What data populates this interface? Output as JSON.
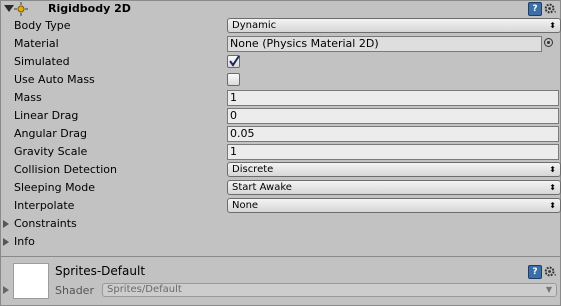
{
  "component": {
    "title": "Rigidbody 2D",
    "help_glyph": "?",
    "icons": [
      "fold-triangle-icon",
      "rigidbody-2d-icon",
      "help-book-icon",
      "gear-icon"
    ]
  },
  "properties": {
    "body_type": {
      "label": "Body Type",
      "value": "Dynamic"
    },
    "material": {
      "label": "Material",
      "value": "None (Physics Material 2D)"
    },
    "simulated": {
      "label": "Simulated",
      "checked": true
    },
    "use_auto_mass": {
      "label": "Use Auto Mass",
      "checked": false
    },
    "mass": {
      "label": "Mass",
      "value": "1"
    },
    "linear_drag": {
      "label": "Linear Drag",
      "value": "0"
    },
    "angular_drag": {
      "label": "Angular Drag",
      "value": "0.05"
    },
    "gravity_scale": {
      "label": "Gravity Scale",
      "value": "1"
    },
    "collision_detection": {
      "label": "Collision Detection",
      "value": "Discrete"
    },
    "sleeping_mode": {
      "label": "Sleeping Mode",
      "value": "Start Awake"
    },
    "interpolate": {
      "label": "Interpolate",
      "value": "None"
    },
    "constraints": {
      "label": "Constraints"
    },
    "info": {
      "label": "Info"
    }
  },
  "material_section": {
    "name": "Sprites-Default",
    "shader_label": "Shader",
    "shader_value": "Sprites/Default",
    "help_glyph": "?"
  },
  "glyphs": {
    "caret": "⬍"
  },
  "colors": {
    "panel_bg": "#c2c2c2",
    "field_bg": "#ececec",
    "help_blue": "#3c6fa8"
  }
}
